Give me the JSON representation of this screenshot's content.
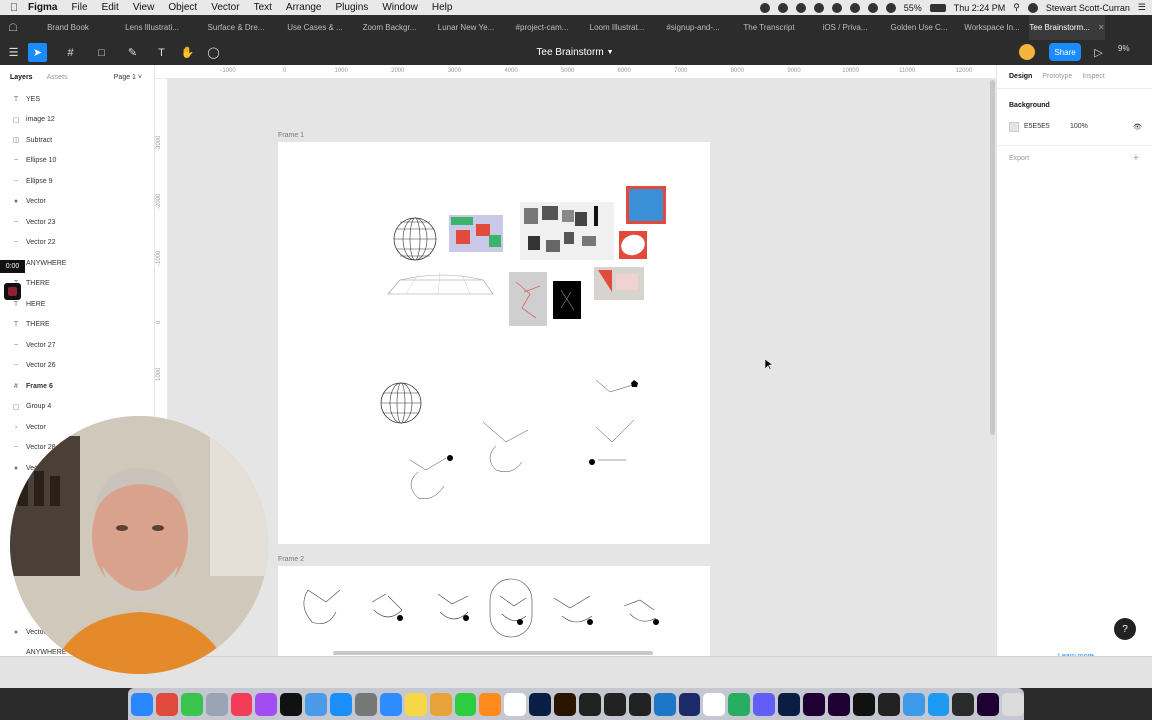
{
  "menubar": {
    "app": "Figma",
    "items": [
      "File",
      "Edit",
      "View",
      "Object",
      "Vector",
      "Text",
      "Arrange",
      "Plugins",
      "Window",
      "Help"
    ],
    "battery": "55%",
    "clock": "Thu 2:24 PM",
    "user": "Stewart Scott-Curran"
  },
  "tabs": [
    {
      "label": "Brand Book",
      "w": 84
    },
    {
      "label": "Lens Illustrati...",
      "w": 84
    },
    {
      "label": "Surface & Dre...",
      "w": 84
    },
    {
      "label": "Use Cases & ...",
      "w": 74
    },
    {
      "label": "Zoom Backgr...",
      "w": 75
    },
    {
      "label": "Lunar New Ye...",
      "w": 78
    },
    {
      "label": "#project-cam...",
      "w": 74
    },
    {
      "label": "Loom Illustrat...",
      "w": 76
    },
    {
      "label": "#signup-and-...",
      "w": 76
    },
    {
      "label": "The Transcript",
      "w": 76
    },
    {
      "label": "iOS / Priva...",
      "w": 76
    },
    {
      "label": "Golden Use C...",
      "w": 72
    },
    {
      "label": "Workspace In...",
      "w": 74
    },
    {
      "label": "Tee Brainstorm...",
      "w": 76,
      "active": true
    }
  ],
  "toolbar": {
    "title": "Tee Brainstorm",
    "share_label": "Share",
    "zoom": "9%"
  },
  "layers_panel": {
    "tab_layers": "Layers",
    "tab_assets": "Assets",
    "page": "Page 1",
    "rows": [
      {
        "icon": "T",
        "label": "YES"
      },
      {
        "icon": "▢",
        "label": "image 12"
      },
      {
        "icon": "◫",
        "label": "Subtract"
      },
      {
        "icon": "~",
        "label": "Ellipse 10"
      },
      {
        "icon": "~",
        "label": "Ellipse 9"
      },
      {
        "icon": "●",
        "label": "Vector"
      },
      {
        "icon": "~",
        "label": "Vector 23"
      },
      {
        "icon": "~",
        "label": "Vector 22"
      },
      {
        "icon": "T",
        "label": "ANYWHERE"
      },
      {
        "icon": "T",
        "label": "THERE"
      },
      {
        "icon": "T",
        "label": "HERE"
      },
      {
        "icon": "T",
        "label": "THERE"
      },
      {
        "icon": "~",
        "label": "Vector 27"
      },
      {
        "icon": "~",
        "label": "Vector 26"
      },
      {
        "icon": "#",
        "label": "Frame 6",
        "bold": true
      },
      {
        "icon": "▢",
        "label": "Group 4"
      },
      {
        "icon": "›",
        "label": "Vector"
      },
      {
        "icon": "~",
        "label": "Vector 28"
      },
      {
        "icon": "●",
        "label": "Vector"
      },
      {
        "icon": "",
        "label": ""
      },
      {
        "icon": "",
        "label": ""
      },
      {
        "icon": "",
        "label": ""
      },
      {
        "icon": "",
        "label": ""
      },
      {
        "icon": "",
        "label": ""
      },
      {
        "icon": "",
        "label": ""
      },
      {
        "icon": "",
        "label": ""
      },
      {
        "icon": "●",
        "label": "Vector"
      },
      {
        "icon": "",
        "label": "ANYWHERE"
      }
    ]
  },
  "rulers": {
    "top": [
      "-1000",
      "0",
      "1000",
      "2000",
      "3000",
      "4000",
      "5000",
      "6000",
      "7000",
      "8000",
      "9000",
      "10000",
      "11000",
      "12000"
    ],
    "left": [
      "-3000",
      "-2000",
      "-1000",
      "0",
      "1000"
    ]
  },
  "canvas": {
    "frame1_label": "Frame 1",
    "frame2_label": "Frame 2"
  },
  "design_panel": {
    "tab_design": "Design",
    "tab_prototype": "Prototype",
    "tab_inspect": "Inspect",
    "background_label": "Background",
    "background_hex": "E5E5E5",
    "background_opacity": "100%",
    "export_label": "Export",
    "learn_more": "Learn more"
  },
  "recording": {
    "timer": "0:00"
  },
  "colors": {
    "accent": "#1a8cff",
    "canvas": "#e5e5e5",
    "toolbar": "#2c2c2c"
  },
  "dock": {
    "icons": [
      "finder-icon",
      "chrome-icon",
      "facetime-icon",
      "preview-icon",
      "music-icon",
      "podcasts-icon",
      "tv-icon",
      "pencil-icon",
      "appstore-icon",
      "settings-icon",
      "zoom-icon",
      "notes-icon",
      "slack-icon",
      "messages-icon",
      "firefox-icon",
      "clock-icon",
      "photoshop-icon",
      "illustrator-icon",
      "figma-icon",
      "acrobat-icon",
      "ia-writer-icon",
      "vpn-icon",
      "rush-icon",
      "script-icon",
      "network-icon",
      "loom-icon",
      "lightroom-icon",
      "premiere-icon",
      "media-encoder-icon",
      "notion-icon",
      "keyboard-icon",
      "cleanmaster-icon",
      "safari-icon",
      "steam-icon",
      "me-icon",
      "trash-icon"
    ],
    "colors": [
      "#2a86ff",
      "#e04a3c",
      "#3bc44b",
      "#9aa4b5",
      "#f23c58",
      "#a14df2",
      "#111111",
      "#4a9ae8",
      "#1c8ef9",
      "#777777",
      "#2d8cff",
      "#f7d648",
      "#e8a23a",
      "#2ecc40",
      "#ff8a1e",
      "#ffffff",
      "#0a1e44",
      "#2a1400",
      "#222222",
      "#222222",
      "#222222",
      "#1e76c8",
      "#1d2a6a",
      "#ffffff",
      "#27ae60",
      "#625df5",
      "#0a1e44",
      "#1e0033",
      "#1e0033",
      "#111111",
      "#222222",
      "#3c9ae8",
      "#1e9af2",
      "#2a2a2a",
      "#1e0033",
      "#dcdcdc"
    ]
  }
}
